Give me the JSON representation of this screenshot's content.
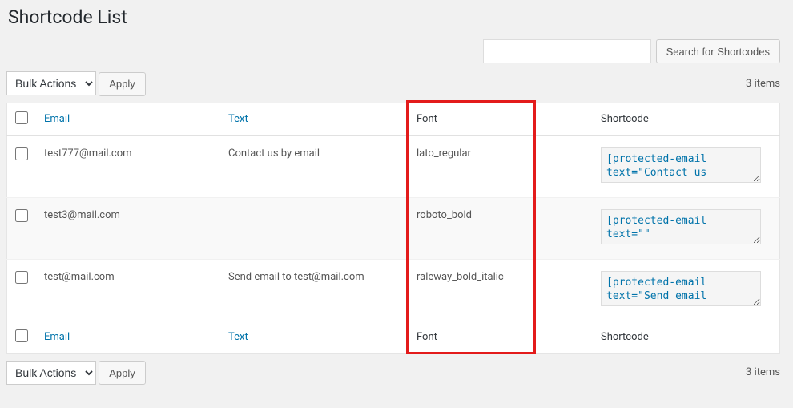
{
  "page": {
    "title": "Shortcode List"
  },
  "search": {
    "placeholder": "",
    "button": "Search for Shortcodes"
  },
  "bulk": {
    "label": "Bulk Actions",
    "apply": "Apply"
  },
  "count_label": "3 items",
  "columns": {
    "email": "Email",
    "text": "Text",
    "font": "Font",
    "shortcode": "Shortcode"
  },
  "rows": [
    {
      "email": "test777@mail.com",
      "text": "Contact us by email",
      "font": "lato_regular",
      "shortcode": "[protected-email text=\"Contact us "
    },
    {
      "email": "test3@mail.com",
      "text": "",
      "font": "roboto_bold",
      "shortcode": "[protected-email text=\"\""
    },
    {
      "email": "test@mail.com",
      "text": "Send email to test@mail.com",
      "font": "raleway_bold_italic",
      "shortcode": "[protected-email text=\"Send email "
    }
  ]
}
